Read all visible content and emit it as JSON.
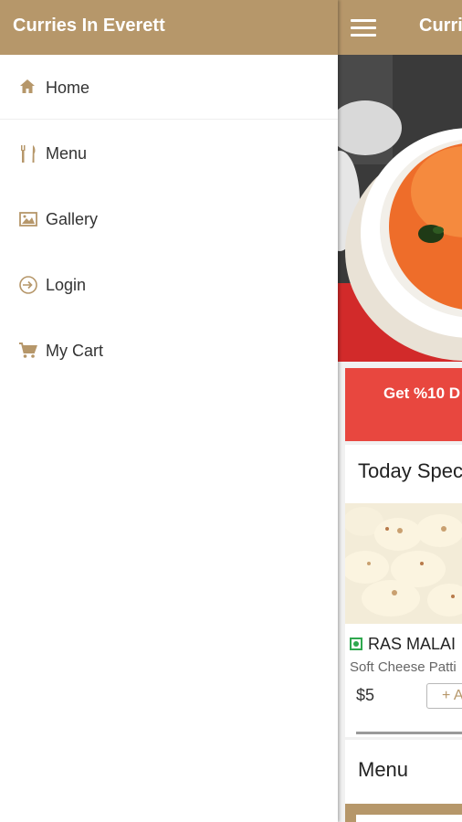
{
  "drawer": {
    "title": "Curries In Everett",
    "items": [
      {
        "label": "Home",
        "icon": "home-icon"
      },
      {
        "label": "Menu",
        "icon": "fork-knife-icon"
      },
      {
        "label": "Gallery",
        "icon": "image-icon"
      },
      {
        "label": "Login",
        "icon": "login-icon"
      },
      {
        "label": "My Cart",
        "icon": "cart-icon"
      }
    ]
  },
  "app": {
    "title": "Curri",
    "promo_text": "Get %10 D",
    "today_special_title": "Today Spec",
    "special_item": {
      "name": "RAS MALAI",
      "description": "Soft Cheese Patti",
      "price": "$5",
      "add_label": "+ A"
    },
    "menu_title": "Menu"
  },
  "colors": {
    "brand": "#b6976a",
    "promo": "#e8473f",
    "veg": "#2fa84f"
  }
}
